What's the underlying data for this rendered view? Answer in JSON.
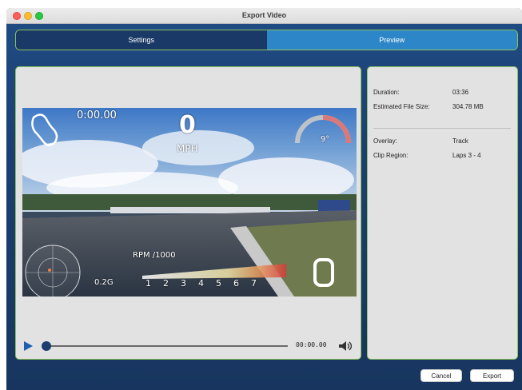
{
  "window": {
    "title": "Export Video"
  },
  "tabs": [
    {
      "label": "Settings",
      "active": false
    },
    {
      "label": "Preview",
      "active": true
    }
  ],
  "video_overlay": {
    "lap_time": "0:00.00",
    "speed_value": "0",
    "speed_unit": "MPH",
    "lean_angle": "9°",
    "rpm_label": "RPM /1000",
    "rpm_ticks": [
      "1",
      "2",
      "3",
      "4",
      "5",
      "6",
      "7"
    ],
    "g_force": "0.2G",
    "gear": "0",
    "icons": [
      "track-map-icon",
      "g-force-circle-icon",
      "lean-angle-gauge-icon"
    ]
  },
  "player": {
    "time": "00:00.00",
    "progress": 0
  },
  "info": {
    "duration_label": "Duration:",
    "duration_value": "03:36",
    "filesize_label": "Estimated File Size:",
    "filesize_value": "304.78 MB",
    "overlay_label": "Overlay:",
    "overlay_value": "Track",
    "clip_label": "Clip Region:",
    "clip_value": "Laps 3 - 4"
  },
  "buttons": {
    "cancel": "Cancel",
    "export": "Export"
  },
  "colors": {
    "window_bg": "#1c3f73",
    "tab_active": "#2c86c8",
    "panel_border": "#8cc45a",
    "panel_bg": "#e2e2e2"
  }
}
